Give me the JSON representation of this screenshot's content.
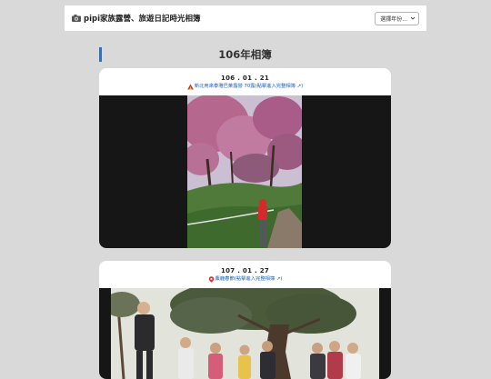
{
  "header": {
    "site_title": "pipi家族露營、旅遊日記時光相簿",
    "year_select": {
      "selected": "選擇年份..."
    }
  },
  "section": {
    "title": "106年相簿"
  },
  "albums": [
    {
      "date": "106 . 01 . 21",
      "link_text": "新北烏來泰雅巴萊露營 70露(點擊進入完整相簿 ↗)",
      "icon": "camping-tent-icon"
    },
    {
      "date": "107 . 01 . 27",
      "link_text": "麋鹿春節(點擊進入完整相簿 ↗)",
      "icon": "map-pin-icon"
    }
  ],
  "colors": {
    "page_bg": "#d9d9d9",
    "accent": "#1a73e8",
    "link": "#1a5fb4"
  }
}
